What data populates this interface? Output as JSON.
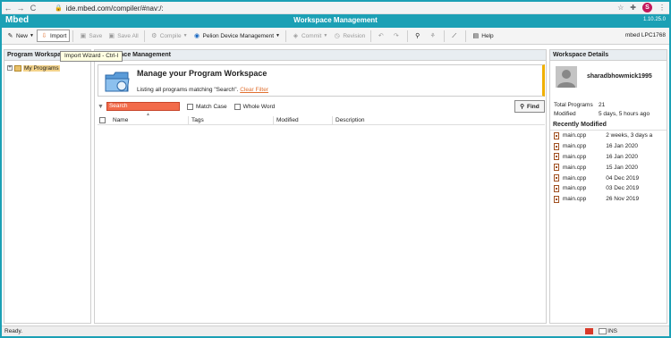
{
  "browser": {
    "url": "ide.mbed.com/compiler/#nav:/:",
    "back_icon": "←",
    "forward_icon": "→",
    "reload_icon": "C",
    "profile_initial": "S"
  },
  "app": {
    "brand": "Mbed",
    "title": "Workspace Management",
    "version": "1.10.25.0"
  },
  "toolbar": {
    "new_label": "New",
    "import_label": "Import",
    "save_label": "Save",
    "save_all_label": "Save All",
    "compile_label": "Compile",
    "pelion_label": "Pelion Device Management",
    "commit_label": "Commit",
    "revision_label": "Revision",
    "help_label": "Help",
    "target_label": "mbed LPC1768"
  },
  "tooltip": "Import Wizard - Ctrl-I",
  "left_panel": {
    "title": "Program Workspace",
    "tree_item": "My Programs"
  },
  "center_panel": {
    "title": "Workspace Management",
    "heading": "Manage your Program Workspace",
    "listing_text": "Listing all programs matching \"Search\".",
    "clear_filter": "Clear Filter",
    "search_value": "Search",
    "match_case": "Match Case",
    "whole_word": "Whole Word",
    "find_label": "Find",
    "columns": [
      "Name",
      "Tags",
      "Modified",
      "Description"
    ]
  },
  "right_panel": {
    "title": "Workspace Details",
    "username": "sharadbhowmick1995",
    "total_programs_label": "Total Programs",
    "total_programs_value": "21",
    "modified_label": "Modified",
    "modified_value": "5 days, 5 hours ago",
    "recent_title": "Recently Modified",
    "recent": [
      {
        "name": "main.cpp",
        "date": "2 weeks, 3 days a"
      },
      {
        "name": "main.cpp",
        "date": "16 Jan 2020"
      },
      {
        "name": "main.cpp",
        "date": "16 Jan 2020"
      },
      {
        "name": "main.cpp",
        "date": "15 Jan 2020"
      },
      {
        "name": "main.cpp",
        "date": "04 Dec 2019"
      },
      {
        "name": "main.cpp",
        "date": "03 Dec 2019"
      },
      {
        "name": "main.cpp",
        "date": "26 Nov 2019"
      }
    ]
  },
  "status": {
    "text": "Ready.",
    "ins": "INS"
  },
  "colors": {
    "brand": "#1ba0b5",
    "search_bg": "#f26b4a",
    "info_accent": "#f0b000"
  }
}
